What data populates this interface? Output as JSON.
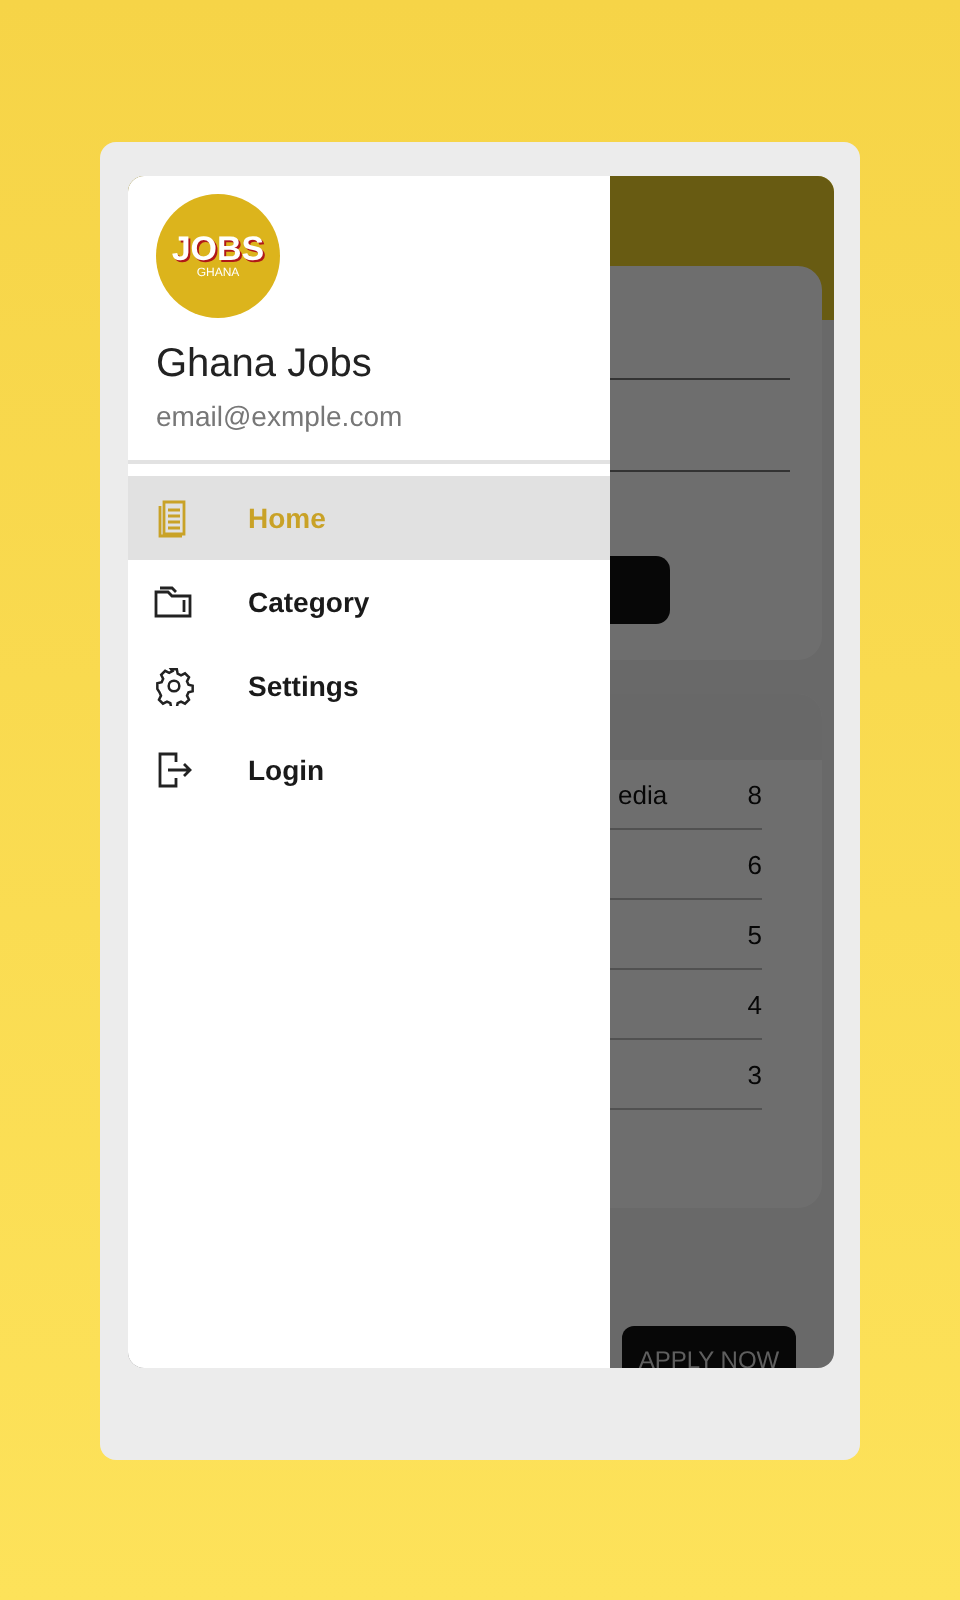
{
  "drawer": {
    "logo": {
      "text": "JOBS",
      "subtext": "GHANA"
    },
    "title": "Ghana Jobs",
    "email": "email@exmple.com",
    "items": [
      {
        "label": "Home",
        "selected": true
      },
      {
        "label": "Category",
        "selected": false
      },
      {
        "label": "Settings",
        "selected": false
      },
      {
        "label": "Login",
        "selected": false
      }
    ]
  },
  "background": {
    "rows": [
      {
        "label": "edia",
        "count": "8"
      },
      {
        "count": "6"
      },
      {
        "count": "5"
      },
      {
        "count": "4"
      },
      {
        "count": "3"
      }
    ],
    "apply_button": "APPLY NOW"
  }
}
